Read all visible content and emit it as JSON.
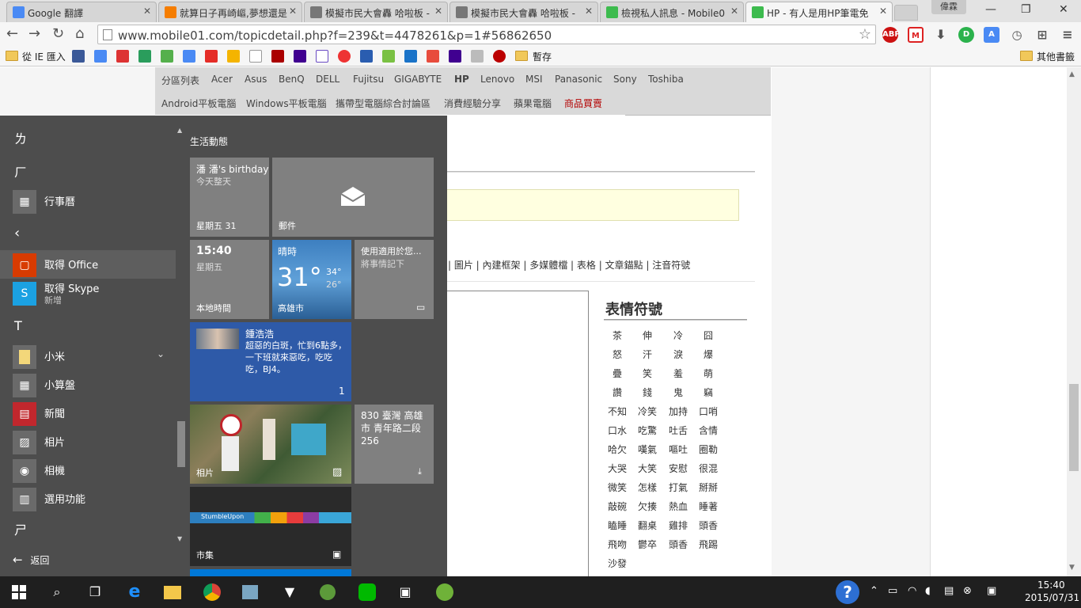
{
  "tabs": [
    {
      "title": "Google 翻譯",
      "color": "#4a8af4",
      "active": false
    },
    {
      "title": "就算日子再崎嶇,夢想還是",
      "color": "#f57d00",
      "active": false
    },
    {
      "title": "模擬市民大會轟 哈啦板 -",
      "color": "#666666",
      "active": false
    },
    {
      "title": "模擬市民大會轟 哈啦板 -",
      "color": "#666666",
      "active": false
    },
    {
      "title": "檢視私人訊息 - Mobile0",
      "color": "#3dbb4e",
      "active": false
    },
    {
      "title": "HP - 有人是用HP筆電免",
      "color": "#3dbb4e",
      "active": true
    }
  ],
  "profile_name": "偉霖",
  "url": "www.mobile01.com/topicdetail.php?f=239&t=4478261&p=1#56862650",
  "bookmarks": {
    "ie_import": "從 IE 匯入",
    "temp_folder": "暫存",
    "other_bookmarks": "其他書籤",
    "icons": [
      "facebook-icon",
      "google-plus-icon",
      "gmail-icon",
      "play-store-icon",
      "maps-icon",
      "translate-icon",
      "youtube-icon",
      "drive-icon",
      "wikipedia-icon",
      "game-icon",
      "yahoo-icon",
      "e-icon",
      "pin-icon",
      "calendar-icon",
      "evernote-icon",
      "crown-icon",
      "music-icon",
      "yahoo-icon",
      "link-icon",
      "pixnet-icon"
    ]
  },
  "brand_nav": [
    "分區列表",
    "Acer",
    "Asus",
    "BenQ",
    "DELL",
    "Fujitsu",
    "GIGABYTE",
    "HP",
    "Lenovo",
    "MSI",
    "Panasonic",
    "Sony",
    "Toshiba"
  ],
  "sub_nav": [
    "Android平板電腦",
    "Windows平板電腦",
    "攜帶型電腦綜合討論區",
    "消費經驗分享",
    "蘋果電腦",
    "商品買賣"
  ],
  "editor_tools": "| 圖片 | 內建框架 | 多媒體檔 | 表格 | 文章錨點 | 注音符號",
  "emoticons": {
    "title": "表情符號",
    "items": [
      "茶",
      "伸",
      "冷",
      "囧",
      "怒",
      "汗",
      "淚",
      "爆",
      "疊",
      "笑",
      "羞",
      "萌",
      "讚",
      "錢",
      "鬼",
      "竊",
      "不知",
      "冷笑",
      "加持",
      "口哨",
      "口水",
      "吃驚",
      "吐舌",
      "含情",
      "哈欠",
      "嘆氣",
      "嘔吐",
      "圈勒",
      "大哭",
      "大笑",
      "安慰",
      "很混",
      "微笑",
      "怎樣",
      "打氣",
      "掰掰",
      "敲碗",
      "欠揍",
      "熱血",
      "睡著",
      "瞌睡",
      "翻桌",
      "雞排",
      "頭香",
      "飛吻",
      "鬱卒",
      "頭香",
      "飛踢",
      "沙發"
    ]
  },
  "start_menu": {
    "letters": [
      "ㄌ",
      "ㄏ",
      "T",
      "ㄕ"
    ],
    "apps": [
      {
        "label": "行事曆",
        "sub": "",
        "icon": "calendar-icon",
        "color": "#6a6a6a"
      },
      {
        "label": "取得 Office",
        "sub": "",
        "icon": "office-icon",
        "color": "#d83b01"
      },
      {
        "label": "取得 Skype",
        "sub": "新增",
        "icon": "skype-icon",
        "color": "#1ba1e2"
      },
      {
        "label": "小米",
        "sub": "",
        "icon": "folder-icon",
        "color": "#6a6a6a"
      },
      {
        "label": "小算盤",
        "sub": "",
        "icon": "calculator-icon",
        "color": "#6a6a6a"
      },
      {
        "label": "新聞",
        "sub": "",
        "icon": "news-icon",
        "color": "#c1272d"
      },
      {
        "label": "相片",
        "sub": "",
        "icon": "photos-icon",
        "color": "#6a6a6a"
      },
      {
        "label": "相機",
        "sub": "",
        "icon": "camera-icon",
        "color": "#6a6a6a"
      },
      {
        "label": "選用功能",
        "sub": "",
        "icon": "features-icon",
        "color": "#6a6a6a"
      }
    ],
    "back_label": "返回",
    "tiles_title": "生活動態",
    "tiles": {
      "birthday": {
        "title": "潘 潘's birthday",
        "sub": "今天整天",
        "foot": "星期五 31"
      },
      "mail": {
        "name": "郵件"
      },
      "clock": {
        "time": "15:40",
        "day": "星期五",
        "name": "本地時間"
      },
      "weather": {
        "label": "晴時",
        "temp": "31°",
        "high": "34°",
        "low": "26°",
        "city": "高雄市"
      },
      "promo": {
        "title": "使用適用於您...",
        "sub": "將事情記下"
      },
      "people": {
        "name": "鍾浩浩",
        "text": "超惡的白斑，忙到6點多，一下班就來惡吃，吃吃吃，BJ4。",
        "count": "1"
      },
      "photos": {
        "name": "相片"
      },
      "location": {
        "text": "830 臺灣 高雄市 青年路二段 256"
      },
      "store": {
        "name": "市集",
        "banner": "StumbleUpon"
      }
    }
  },
  "taskbar": {
    "time": "15:40",
    "date": "2015/07/31"
  },
  "colors": {
    "start_bg": "#4d4d4d",
    "tile_gray": "#808080",
    "tile_blue": "#2e5aa8",
    "taskbar_bg": "#1f1f1f",
    "sale_red": "#b30000"
  }
}
